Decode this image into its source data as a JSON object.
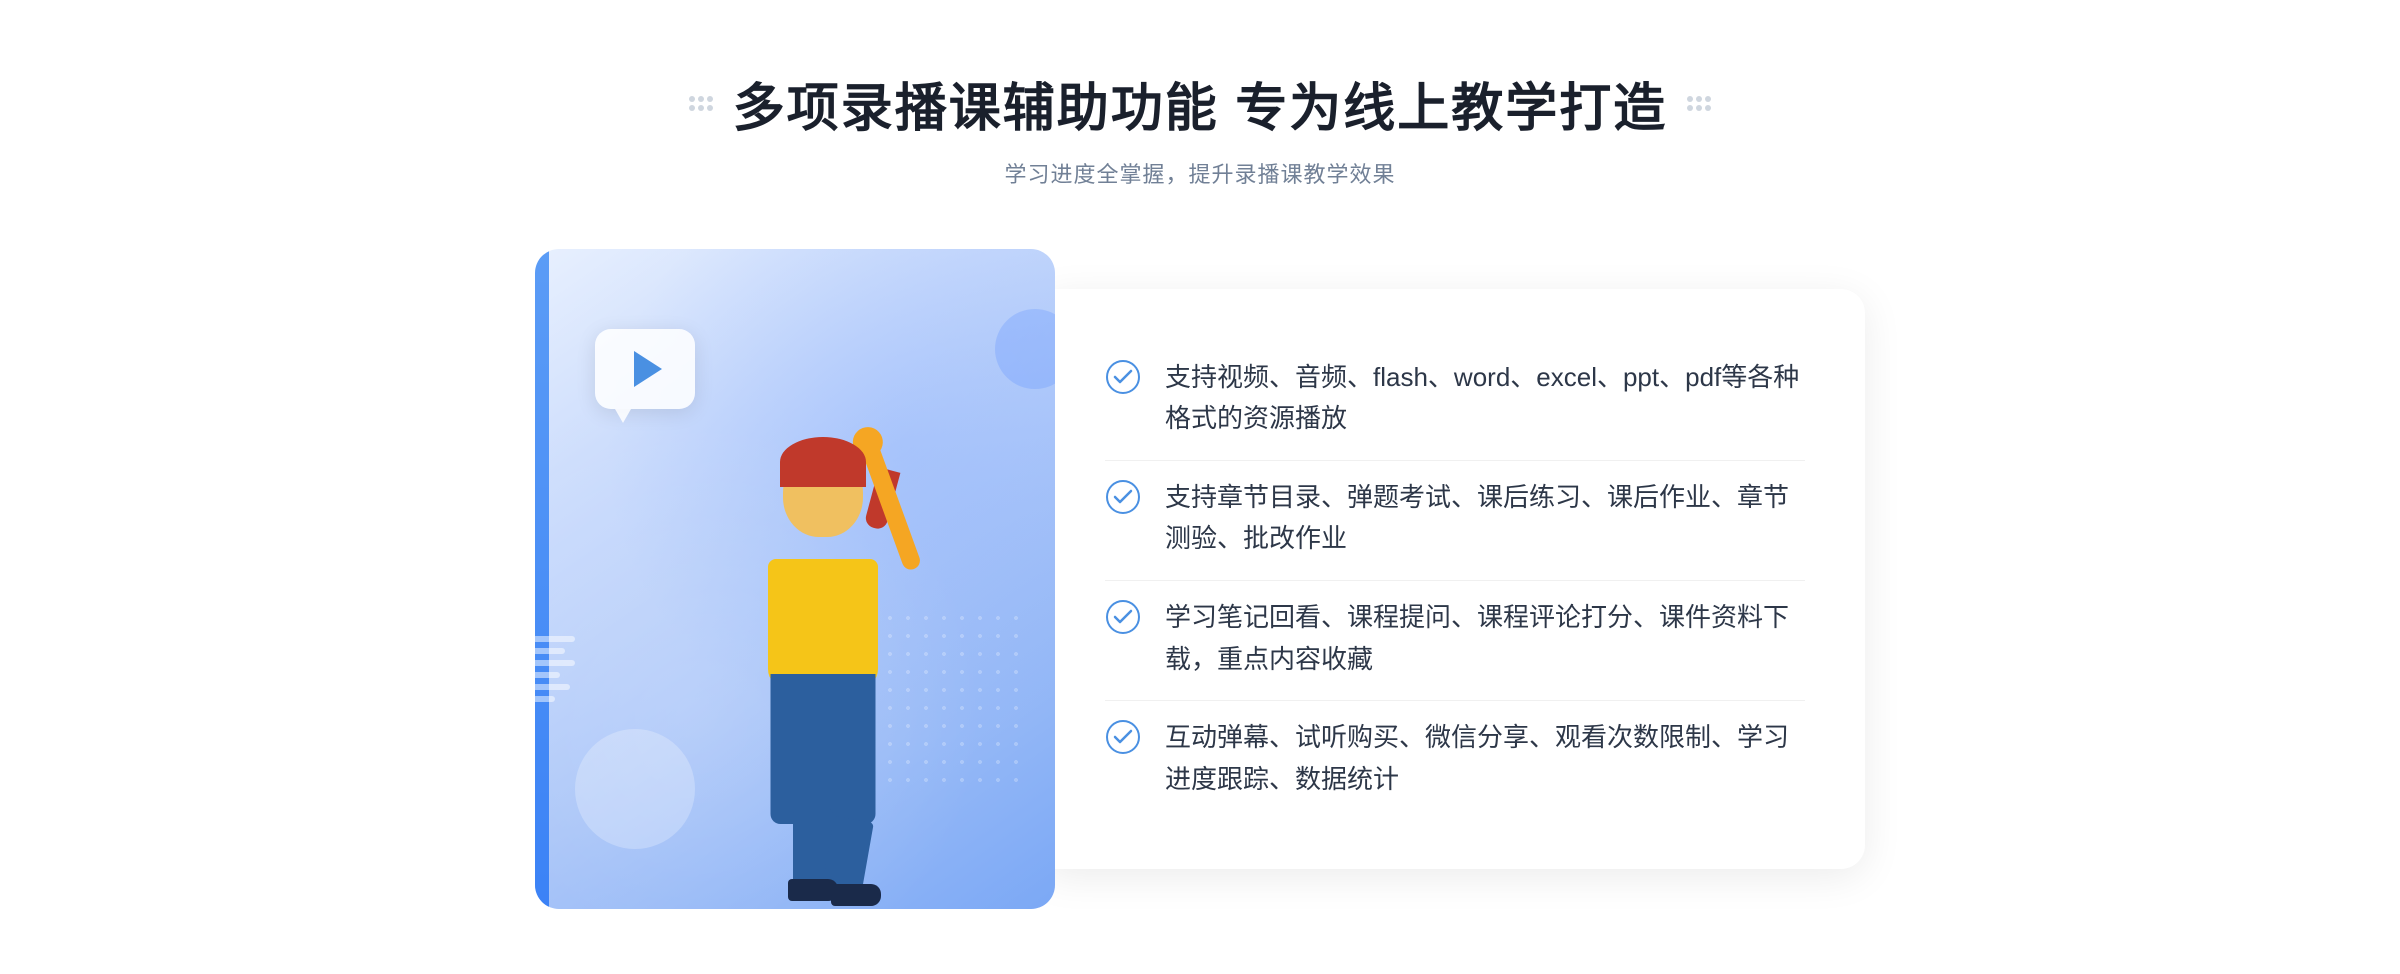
{
  "header": {
    "title": "多项录播课辅助功能 专为线上教学打造",
    "subtitle": "学习进度全掌握，提升录播课教学效果"
  },
  "features": [
    {
      "id": 1,
      "text": "支持视频、音频、flash、word、excel、ppt、pdf等各种格式的资源播放"
    },
    {
      "id": 2,
      "text": "支持章节目录、弹题考试、课后练习、课后作业、章节测验、批改作业"
    },
    {
      "id": 3,
      "text": "学习笔记回看、课程提问、课程评论打分、课件资料下载，重点内容收藏"
    },
    {
      "id": 4,
      "text": "互动弹幕、试听购买、微信分享、观看次数限制、学习进度跟踪、数据统计"
    }
  ],
  "decorations": {
    "left_arrow": "»",
    "dot_grid_label": "decorative dot grid"
  }
}
